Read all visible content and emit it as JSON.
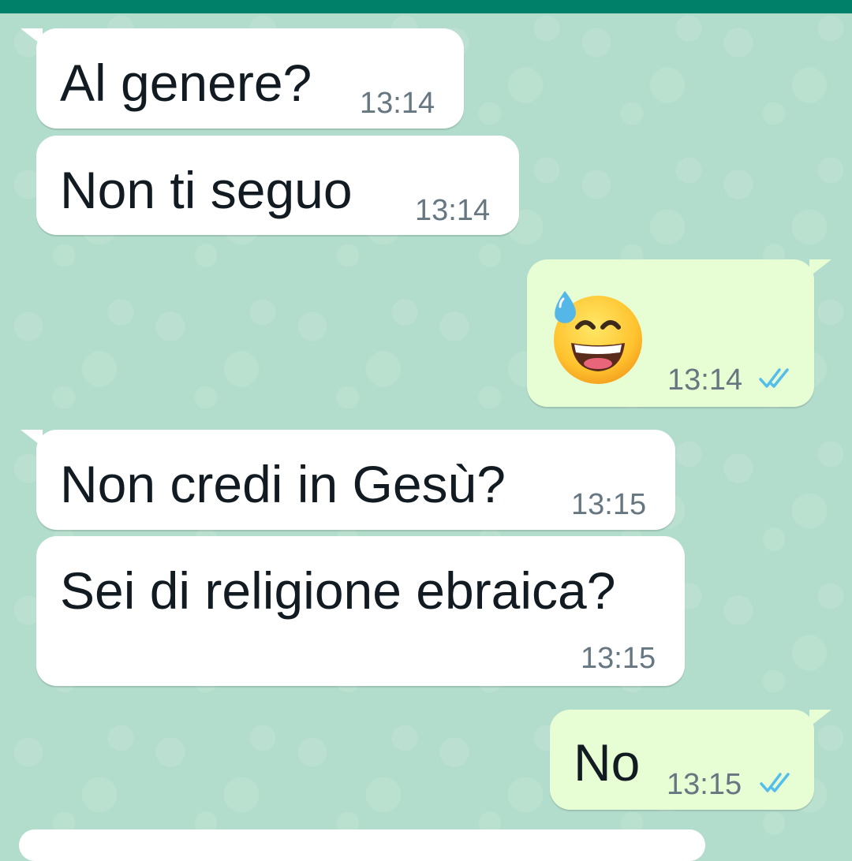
{
  "header": {
    "color": "#008069"
  },
  "theme": {
    "chat_background": "#b2dccb",
    "incoming_bubble": "#ffffff",
    "outgoing_bubble": "#e7fdd3",
    "tick_color": "#53bdeb"
  },
  "messages": [
    {
      "direction": "in",
      "text": "Al genere?",
      "time": "13:14"
    },
    {
      "direction": "in",
      "text": "Non ti seguo",
      "time": "13:14"
    },
    {
      "direction": "out",
      "emoji": "grinning-face-with-sweat",
      "time": "13:14",
      "status": "read"
    },
    {
      "direction": "in",
      "text": "Non credi in Gesù?",
      "time": "13:15"
    },
    {
      "direction": "in",
      "text": "Sei di religione ebraica?",
      "time": "13:15"
    },
    {
      "direction": "out",
      "text": "No",
      "time": "13:15",
      "status": "read"
    }
  ]
}
